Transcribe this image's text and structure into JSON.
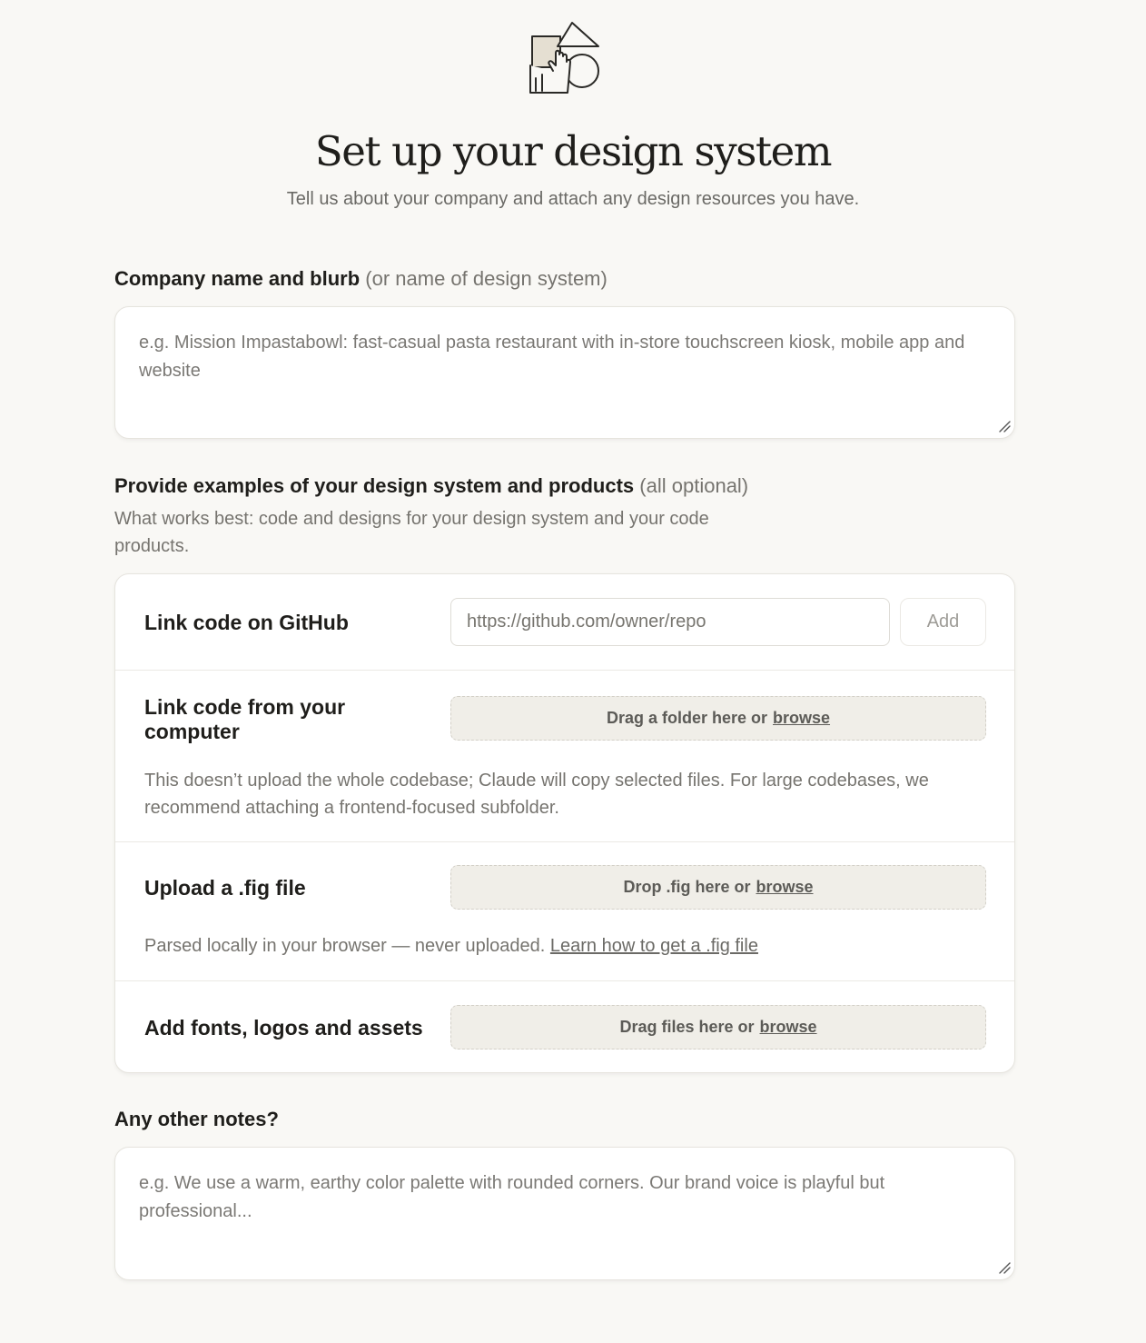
{
  "header": {
    "icon": "shapes-hand-icon",
    "title": "Set up your design system",
    "subtitle": "Tell us about your company and attach any design resources you have."
  },
  "company": {
    "label": "Company name and blurb",
    "label_hint": "(or name of design system)",
    "placeholder": "e.g. Mission Impastabowl: fast-casual pasta restaurant with in-store touchscreen kiosk, mobile app and website",
    "value": ""
  },
  "examples": {
    "label": "Provide examples of your design system and products",
    "label_hint": "(all optional)",
    "help": "What works best: code and designs for your design system and your code products.",
    "github": {
      "title": "Link code on GitHub",
      "placeholder": "https://github.com/owner/repo",
      "value": "",
      "add_label": "Add"
    },
    "computer": {
      "title": "Link code from your computer",
      "drop_text": "Drag a folder here or",
      "browse": "browse",
      "note": "This doesn’t upload the whole codebase; Claude will copy selected files. For large codebases, we recommend attaching a frontend-focused subfolder."
    },
    "fig": {
      "title": "Upload a .fig file",
      "drop_text": "Drop .fig here or",
      "browse": "browse",
      "note": "Parsed locally in your browser — never uploaded.",
      "note_link": "Learn how to get a .fig file"
    },
    "assets": {
      "title": "Add fonts, logos and assets",
      "drop_text": "Drag files here or",
      "browse": "browse"
    }
  },
  "notes": {
    "label": "Any other notes?",
    "placeholder": "e.g. We use a warm, earthy color palette with rounded corners. Our brand voice is playful but professional...",
    "value": ""
  },
  "colors": {
    "background": "#f9f8f5",
    "card": "#ffffff",
    "dropzone": "#f0eee8",
    "text": "#1f1e1b",
    "muted": "#76746f"
  }
}
